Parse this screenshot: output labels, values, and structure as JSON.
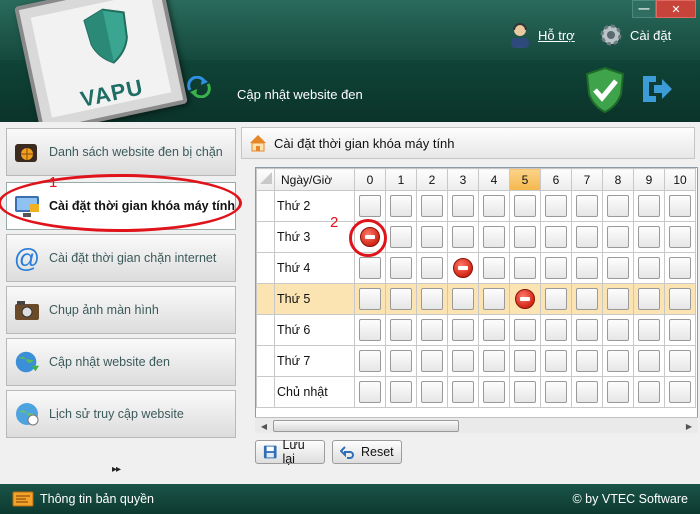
{
  "header": {
    "logo_text": "VAPU",
    "update_title": "Cập nhật website đen",
    "help_label": "Hỗ trợ",
    "settings_label": "Cài đặt",
    "window_min": "—",
    "window_close": "✕"
  },
  "sidebar": {
    "items": [
      {
        "label": "Danh sách website đen bị chặn",
        "icon": "wallet-globe-icon"
      },
      {
        "label": "Cài đặt thời gian khóa máy tính",
        "icon": "computer-lock-icon"
      },
      {
        "label": "Cài đặt thời gian chặn internet",
        "icon": "at-sign-icon"
      },
      {
        "label": "Chụp ảnh màn hình",
        "icon": "camera-icon"
      },
      {
        "label": "Cập nhật website đen",
        "icon": "globe-update-icon"
      },
      {
        "label": "Lịch sử truy cập website",
        "icon": "globe-history-icon"
      }
    ],
    "more": "▸▸"
  },
  "annotations": {
    "one": "1",
    "two": "2"
  },
  "main": {
    "title": "Cài đặt thời gian khóa máy tính",
    "grid": {
      "corner_header": "Ngày/Giờ",
      "hours": [
        "0",
        "1",
        "2",
        "3",
        "4",
        "5",
        "6",
        "7",
        "8",
        "9",
        "10"
      ],
      "highlight_hour": "5",
      "days": [
        {
          "name": "Thứ 2",
          "blocked": []
        },
        {
          "name": "Thứ 3",
          "blocked": [
            "0"
          ]
        },
        {
          "name": "Thứ 4",
          "blocked": [
            "3"
          ]
        },
        {
          "name": "Thứ 5",
          "blocked": [
            "5"
          ],
          "highlight": true
        },
        {
          "name": "Thứ 6",
          "blocked": []
        },
        {
          "name": "Thứ 7",
          "blocked": []
        },
        {
          "name": "Chủ nhật",
          "blocked": []
        }
      ]
    },
    "save_label": "Lưu lại",
    "reset_label": "Reset"
  },
  "footer": {
    "license": "Thông tin bản quyền",
    "copyright": "© by VTEC Software"
  },
  "colors": {
    "header_bg": "#0f4236",
    "highlight": "#f5b74c",
    "annotation": "#e0131b"
  }
}
